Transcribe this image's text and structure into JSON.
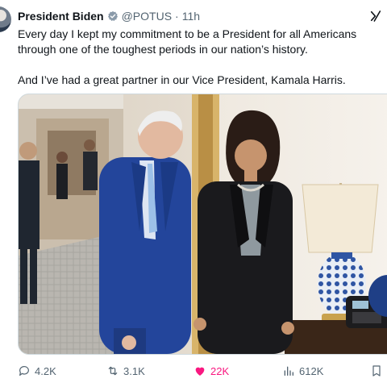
{
  "tweet": {
    "author_name": "President Biden",
    "handle": "@POTUS",
    "separator": "·",
    "time": "11h",
    "paragraphs": [
      "Every day I kept my commitment to be a President for all Americans through one of the toughest periods in our nation’s history.",
      "And I’ve had a great partner in our Vice President, Kamala Harris."
    ]
  },
  "actions": {
    "replies": "4.2K",
    "reposts": "3.1K",
    "likes": "22K",
    "views": "612K"
  },
  "colors": {
    "verified_badge": "#8a9aa9",
    "like_active": "#f91880",
    "muted_text": "#536471"
  },
  "icons": {
    "verified": "verified-badge-icon",
    "grok": "grok-icon",
    "reply": "reply-icon",
    "repost": "repost-icon",
    "like": "heart-icon",
    "views": "views-icon",
    "bookmark": "bookmark-icon"
  }
}
